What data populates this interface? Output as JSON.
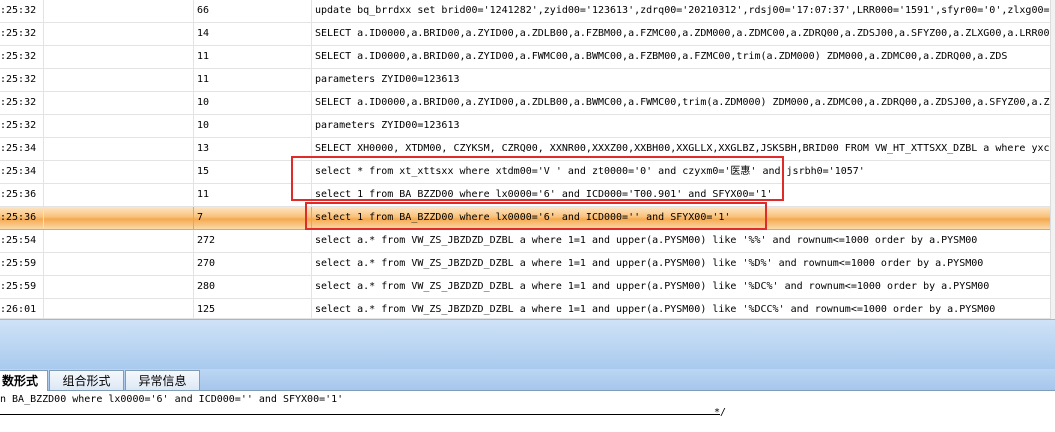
{
  "rows": [
    {
      "time": ":25:32",
      "ms": "66",
      "sql": "update bq_brrdxx set brid00='1241282',zyid00='123613',zdrq00='20210312',rdsj00='17:07:37',LRR000='1591',sfyr00='0',zlxg00='0"
    },
    {
      "time": ":25:32",
      "ms": "14",
      "sql": "SELECT a.ID0000,a.BRID00,a.ZYID00,a.ZDLB00,a.FZBM00,a.FZMC00,a.ZDM000,a.ZDMC00,a.ZDRQ00,a.ZDSJ00,a.SFYZ00,a.ZLXG00,a.LRR000,a"
    },
    {
      "time": ":25:32",
      "ms": "11",
      "sql": "SELECT a.ID0000,a.BRID00,a.ZYID00,a.FWMC00,a.BWMC00,a.FZBM00,a.FZMC00,trim(a.ZDM000) ZDM000,a.ZDMC00,a.ZDRQ00,a.ZDS"
    },
    {
      "time": ":25:32",
      "ms": "11",
      "sql": "parameters ZYID00=123613"
    },
    {
      "time": ":25:32",
      "ms": "10",
      "sql": "SELECT a.ID0000,a.BRID00,a.ZYID00,a.ZDLB00,a.BWMC00,a.FWMC00,trim(a.ZDM000) ZDM000,a.ZDMC00,a.ZDRQ00,a.ZDSJ00,a.SFYZ00,a.ZLX"
    },
    {
      "time": ":25:32",
      "ms": "10",
      "sql": "parameters ZYID00=123613"
    },
    {
      "time": ":25:34",
      "ms": "13",
      "sql": "SELECT XH0000, XTDM00, CZYKSM, CZRQ00, XXNR00,XXXZ00,XXBH00,XXGLLX,XXGLBZ,JSKSBH,BRID00   FROM VW_HT_XTTSXX_DZBL a where yxc"
    },
    {
      "time": ":25:34",
      "ms": "15",
      "sql": "select * from xt_xttsxx where xtdm00='V '  and zt0000='0' and czyxm0='医惠'  and  jsrbh0='1057'"
    },
    {
      "time": ":25:36",
      "ms": "11",
      "sql": "select 1 from BA_BZZD00 where lx0000='6' and ICD000='T00.901' and SFYX00='1'"
    },
    {
      "time": ":25:36",
      "ms": "7",
      "sql": "select 1 from BA_BZZD00 where lx0000='6' and ICD000='' and SFYX00='1'"
    },
    {
      "time": ":25:54",
      "ms": "272",
      "sql": "select a.* from VW_ZS_JBZDZD_DZBL a where 1=1  and upper(a.PYSM00) like '%%' and rownum<=1000 order by a.PYSM00"
    },
    {
      "time": ":25:59",
      "ms": "270",
      "sql": "select a.* from VW_ZS_JBZDZD_DZBL a where 1=1  and upper(a.PYSM00) like '%D%' and rownum<=1000 order by a.PYSM00"
    },
    {
      "time": ":25:59",
      "ms": "280",
      "sql": "select a.* from VW_ZS_JBZDZD_DZBL a where 1=1  and upper(a.PYSM00) like '%DC%' and rownum<=1000 order by a.PYSM00"
    },
    {
      "time": ":26:01",
      "ms": "125",
      "sql": "select a.* from VW_ZS_JBZDZD_DZBL a where 1=1  and upper(a.PYSM00) like '%DCC%' and rownum<=1000 order by a.PYSM00"
    }
  ],
  "selected_row_index": 9,
  "tabs": [
    {
      "label": "数形式",
      "active": true
    },
    {
      "label": "组合形式",
      "active": false
    },
    {
      "label": "异常信息",
      "active": false
    }
  ],
  "detail": {
    "sql_text": "n BA_BZZD00 where lx0000='6' and ICD000='' and SFYX00='1'",
    "tail": "*/"
  },
  "colors": {
    "selected_row": "#f9c17a",
    "highlight_border": "#e02b2b",
    "splitter": "#a9caee"
  }
}
